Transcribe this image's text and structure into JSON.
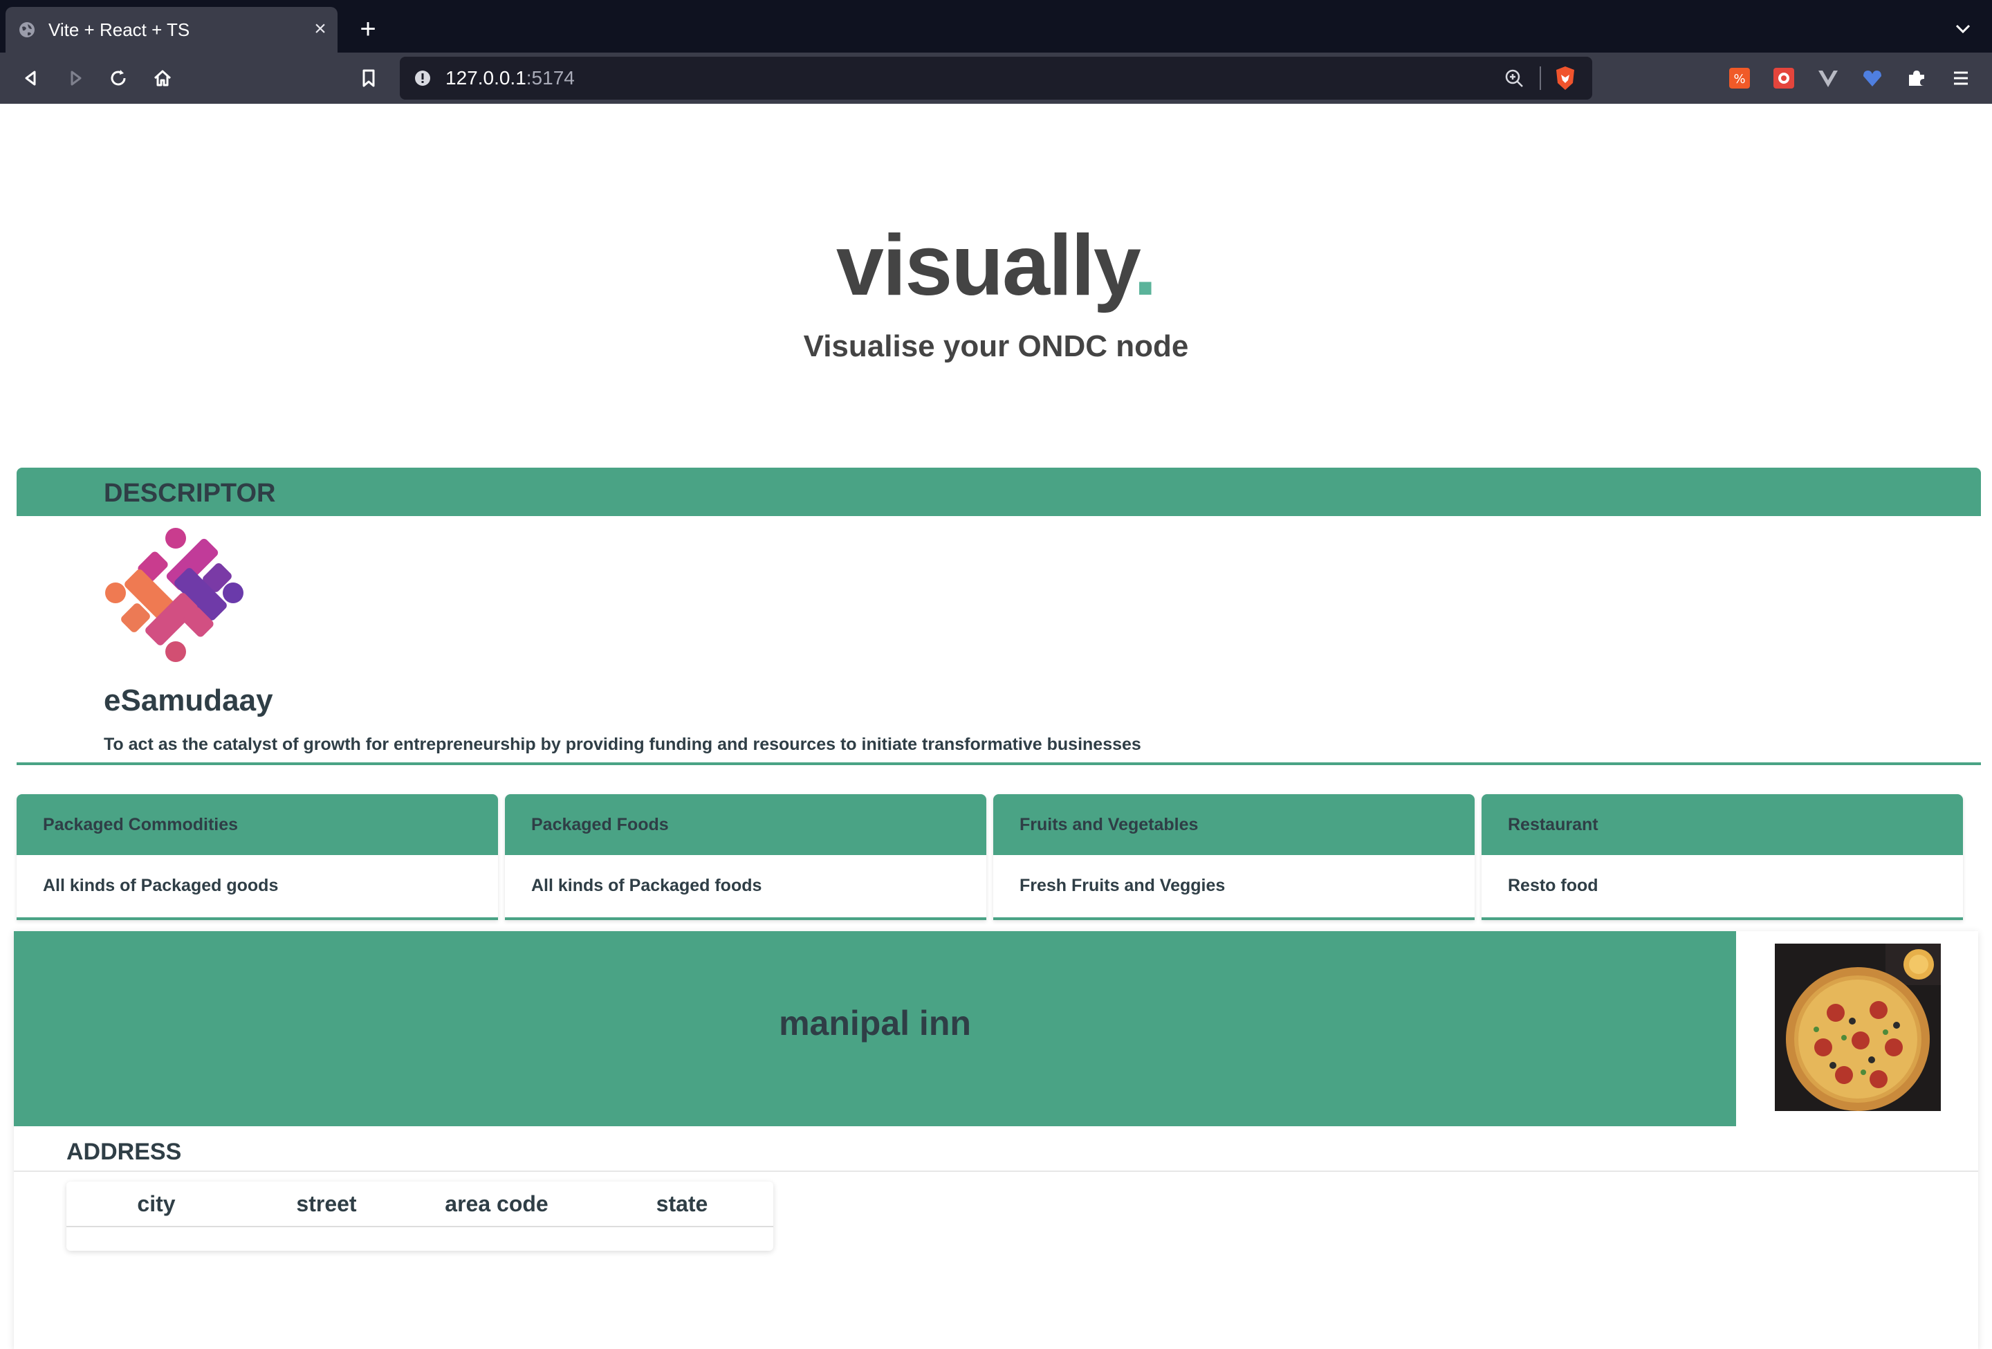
{
  "browser": {
    "tab_title": "Vite + React + TS",
    "url_host": "127.0.0.1",
    "url_port": ":5174"
  },
  "hero": {
    "title": "visually",
    "title_dot": ".",
    "subtitle": "Visualise your ONDC node",
    "accent_color": "#5bb39a"
  },
  "descriptor": {
    "header": "DESCRIPTOR",
    "name": "eSamudaay",
    "short_desc": "To act as the catalyst of growth for entrepreneurship by providing funding and resources to initiate transformative businesses",
    "logo_icon": "esamudaay-logo-icon"
  },
  "categories": [
    {
      "name": "Packaged Commodities",
      "desc": "All kinds of Packaged goods"
    },
    {
      "name": "Packaged Foods",
      "desc": "All kinds of Packaged foods"
    },
    {
      "name": "Fruits and Vegetables",
      "desc": "Fresh Fruits and Veggies"
    },
    {
      "name": "Restaurant",
      "desc": "Resto food"
    }
  ],
  "provider": {
    "name": "manipal inn",
    "image_icon": "pizza-image",
    "address_label": "ADDRESS",
    "address_columns": [
      "city",
      "street",
      "area code",
      "state"
    ]
  },
  "theme": {
    "primary": "#4aa385",
    "text": "#2f3e46",
    "chrome_dark": "#0f1220",
    "chrome_toolbar": "#3b3d4a"
  }
}
